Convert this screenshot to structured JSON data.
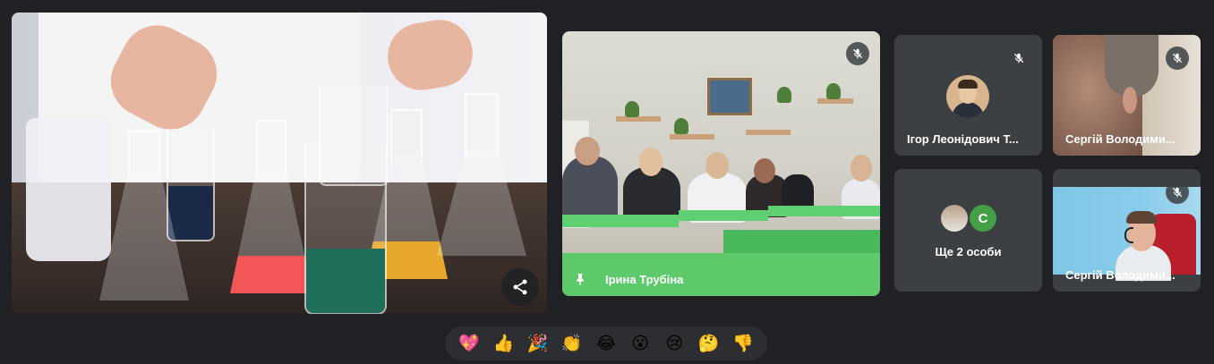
{
  "presentation": {
    "share_icon": "share-icon"
  },
  "tiles": {
    "classroom": {
      "name": "Ірина Трубіна",
      "pinned_icon": "pin-icon",
      "mic": "mic-off-icon"
    },
    "igor": {
      "name": "Ігор Леонідович Т...",
      "mic": "mic-off-icon"
    },
    "serhiy_top": {
      "name": "Сергій Володими...",
      "mic": "mic-off-icon"
    },
    "more": {
      "label": "Ще 2 особи",
      "avatar_letter": "С",
      "avatar_color": "#43a047"
    },
    "serhiy_bottom": {
      "name": "Сергій Володими...",
      "mic": "mic-off-icon"
    }
  },
  "reactions": [
    {
      "name": "sparkling-heart",
      "glyph": "💖"
    },
    {
      "name": "thumbs-up",
      "glyph": "👍"
    },
    {
      "name": "party-popper",
      "glyph": "🎉"
    },
    {
      "name": "clapping-hands",
      "glyph": "👏"
    },
    {
      "name": "tears-of-joy",
      "glyph": "😂"
    },
    {
      "name": "surprised",
      "glyph": "😮"
    },
    {
      "name": "sad",
      "glyph": "😢"
    },
    {
      "name": "thinking",
      "glyph": "🤔"
    },
    {
      "name": "thumbs-down",
      "glyph": "👎"
    }
  ],
  "colors": {
    "background": "#202124",
    "tile": "#3c4043",
    "reaction_bar": "#2d2e31"
  }
}
